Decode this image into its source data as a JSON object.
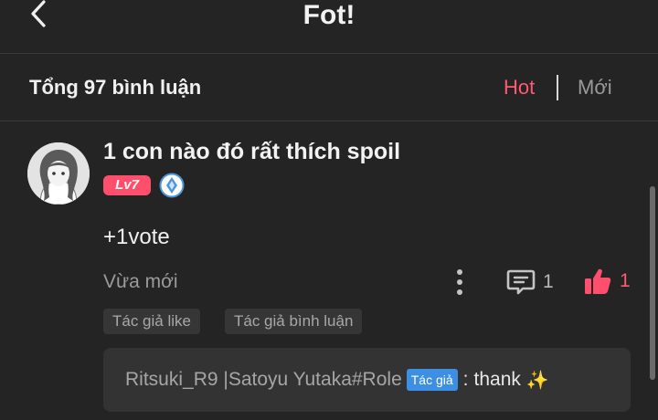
{
  "header": {
    "title": "Fot!"
  },
  "comments_bar": {
    "count_label": "Tổng 97 bình luận",
    "sort_hot": "Hot",
    "sort_new": "Mới"
  },
  "comment": {
    "username": "1 con nào đó rất thích spoil",
    "level": "Lv7",
    "text": "+1vote",
    "timestamp": "Vừa mới",
    "reply_count": "1",
    "like_count": "1",
    "tags": [
      "Tác giả like",
      "Tác giả bình luận"
    ],
    "reply": {
      "author": "Ritsuki_R9 |Satoyu Yutaka#Role",
      "author_badge": "Tác giả",
      "separator": ":",
      "text": "thank",
      "emoji": "✨"
    }
  },
  "colors": {
    "accent": "#ff5a6e",
    "background": "#242424",
    "author_badge": "#3d8fe3"
  },
  "icons": [
    "back-arrow-icon",
    "avatar-image",
    "rank-icon",
    "more-vertical-icon",
    "comment-icon",
    "thumbs-up-icon",
    "sparkle-icon"
  ]
}
